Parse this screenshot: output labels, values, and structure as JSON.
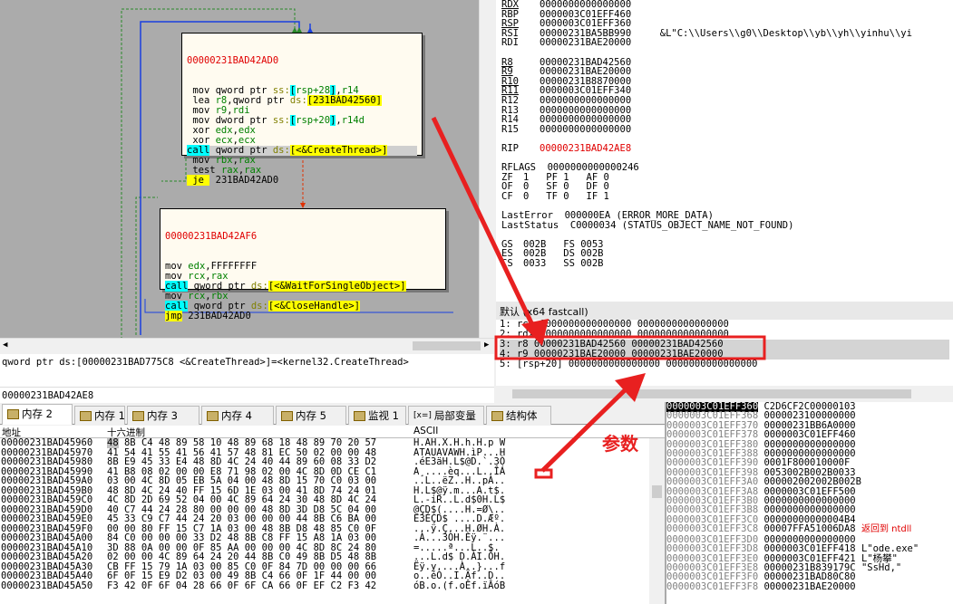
{
  "graph": {
    "node1": {
      "addr": "00000231BAD42AD0",
      "lines": [
        [
          {
            "t": " mov qword ptr "
          },
          {
            "t": "ss:",
            "c": "seg"
          },
          {
            "t": "[",
            "c": "brk"
          },
          {
            "t": "rsp+28",
            "c": "reg"
          },
          {
            "t": "]",
            "c": "brk"
          },
          {
            "t": ","
          },
          {
            "t": "r14",
            "c": "reg"
          }
        ],
        [
          {
            "t": " lea "
          },
          {
            "t": "r8",
            "c": "reg"
          },
          {
            "t": ",qword ptr "
          },
          {
            "t": "ds:",
            "c": "seg"
          },
          {
            "t": "[231BAD42560]",
            "c": "addrhl"
          }
        ],
        [
          {
            "t": " mov "
          },
          {
            "t": "r9",
            "c": "reg"
          },
          {
            "t": ","
          },
          {
            "t": "rdi",
            "c": "reg"
          }
        ],
        [
          {
            "t": " mov dword ptr "
          },
          {
            "t": "ss:",
            "c": "seg"
          },
          {
            "t": "[",
            "c": "brk"
          },
          {
            "t": "rsp+20",
            "c": "reg"
          },
          {
            "t": "]",
            "c": "brk"
          },
          {
            "t": ","
          },
          {
            "t": "r14d",
            "c": "reg"
          }
        ],
        [
          {
            "t": " xor "
          },
          {
            "t": "edx",
            "c": "reg"
          },
          {
            "t": ","
          },
          {
            "t": "edx",
            "c": "reg"
          }
        ],
        [
          {
            "t": " xor "
          },
          {
            "t": "ecx",
            "c": "reg"
          },
          {
            "t": ","
          },
          {
            "t": "ecx",
            "c": "reg"
          }
        ],
        [
          {
            "t": "call",
            "c": "callkw"
          },
          {
            "t": " qword ptr "
          },
          {
            "t": "ds:",
            "c": "seg"
          },
          {
            "t": "[<&CreateThread>]",
            "c": "addrhl"
          }
        ],
        [
          {
            "t": " mov "
          },
          {
            "t": "rbx",
            "c": "reg"
          },
          {
            "t": ","
          },
          {
            "t": "rax",
            "c": "reg"
          }
        ],
        [
          {
            "t": " test "
          },
          {
            "t": "rax",
            "c": "reg"
          },
          {
            "t": ","
          },
          {
            "t": "rax",
            "c": "reg"
          }
        ],
        [
          {
            "t": " je ",
            "c": "jmpkw"
          },
          {
            "t": " 231BAD42AD0"
          }
        ]
      ]
    },
    "node2": {
      "addr": "00000231BAD42AF6",
      "lines": [
        [
          {
            "t": "mov "
          },
          {
            "t": "edx",
            "c": "reg"
          },
          {
            "t": ",FFFFFFFF"
          }
        ],
        [
          {
            "t": "mov "
          },
          {
            "t": "rcx",
            "c": "reg"
          },
          {
            "t": ","
          },
          {
            "t": "rax",
            "c": "reg"
          }
        ],
        [
          {
            "t": "call",
            "c": "callkw"
          },
          {
            "t": " qword ptr "
          },
          {
            "t": "ds:",
            "c": "seg"
          },
          {
            "t": "[<&WaitForSingleObject>]",
            "c": "addrhl"
          }
        ],
        [
          {
            "t": "mov "
          },
          {
            "t": "rcx",
            "c": "reg"
          },
          {
            "t": ","
          },
          {
            "t": "rbx",
            "c": "reg"
          }
        ],
        [
          {
            "t": "call",
            "c": "callkw"
          },
          {
            "t": " qword ptr "
          },
          {
            "t": "ds:",
            "c": "seg"
          },
          {
            "t": "[<&CloseHandle>]",
            "c": "addrhl"
          }
        ],
        [
          {
            "t": "jmp",
            "c": "jmpkw"
          },
          {
            "t": " 231BAD42AD0"
          }
        ]
      ]
    }
  },
  "info": {
    "line1": "qword ptr ds:[00000231BAD775C8 <&CreateThread>]=<kernel32.CreateThread>",
    "line2": "00000231BAD42AE8"
  },
  "registers": {
    "rows": [
      {
        "name": "RDX",
        "value": "0000000000000000",
        "u": true
      },
      {
        "name": "RBP",
        "value": "0000003C01EFF460"
      },
      {
        "name": "RSP",
        "value": "0000003C01EFF360",
        "u": true
      },
      {
        "name": "RSI",
        "value": "00000231BA5BB990",
        "extra": "&L\"C:\\\\Users\\\\g0\\\\Desktop\\\\yb\\\\yh\\\\yinhu\\\\yi"
      },
      {
        "name": "RDI",
        "value": "00000231BAE20000"
      },
      {
        "name": "",
        "value": ""
      },
      {
        "name": "R8",
        "value": "00000231BAD42560",
        "u": true
      },
      {
        "name": "R9",
        "value": "00000231BAE20000",
        "u": true
      },
      {
        "name": "R10",
        "value": "00000231B8870000",
        "u": true
      },
      {
        "name": "R11",
        "value": "0000003C01EFF340",
        "u": true
      },
      {
        "name": "R12",
        "value": "0000000000000000"
      },
      {
        "name": "R13",
        "value": "0000000000000000"
      },
      {
        "name": "R14",
        "value": "0000000000000000"
      },
      {
        "name": "R15",
        "value": "0000000000000000"
      },
      {
        "name": "",
        "value": ""
      },
      {
        "name": "RIP",
        "value": "00000231BAD42AE8",
        "chg": true
      },
      {
        "name": "",
        "value": ""
      },
      {
        "name": "RFLAGS",
        "value": "0000000000000246",
        "wide": true
      },
      {
        "name": "ZF",
        "value": "1   PF 1   AF 0",
        "flag": true
      },
      {
        "name": "OF",
        "value": "0   SF 0   DF 0",
        "flag": true
      },
      {
        "name": "CF",
        "value": "0   TF 0   IF 1",
        "flag": true
      },
      {
        "name": "",
        "value": ""
      },
      {
        "name": "LastError",
        "value": "000000EA (ERROR_MORE_DATA)",
        "wide": true
      },
      {
        "name": "LastStatus",
        "value": "C0000034 (STATUS_OBJECT_NAME_NOT_FOUND)",
        "wide": true
      },
      {
        "name": "",
        "value": ""
      },
      {
        "name": "GS",
        "value": "002B   FS 0053",
        "flag": true
      },
      {
        "name": "ES",
        "value": "002B   DS 002B",
        "flag": true
      },
      {
        "name": "CS",
        "value": "0033   SS 002B",
        "flag": true
      }
    ]
  },
  "callconv": {
    "header": "默认 (x64 fastcall)",
    "rows": [
      "1: rcx 0000000000000000 0000000000000000",
      "2: rdx 0000000000000000 0000000000000000",
      "3: r8 00000231BAD42560 00000231BAD42560",
      "4: r9 00000231BAE20000 00000231BAE20000",
      "5: [rsp+20] 0000000000000000 0000000000000000"
    ]
  },
  "tabs": [
    {
      "label": "内存 2",
      "active": true
    },
    {
      "label": "内存 1"
    },
    {
      "label": "内存 3"
    },
    {
      "label": "内存 4"
    },
    {
      "label": "内存 5"
    },
    {
      "label": "监视 1"
    },
    {
      "label": "局部变量",
      "prefix": "[x=]"
    },
    {
      "label": "结构体"
    }
  ],
  "dump": {
    "headers": {
      "addr": "地址",
      "hex": "十六进制",
      "ascii": "ASCII"
    },
    "rows": [
      {
        "a": "00000231BAD45960",
        "h": "48 8B C4 48 89 58 10 48 89 68 18 48 89 70 20 57",
        "s": "H.AH.X.H.h.H.p W"
      },
      {
        "a": "00000231BAD45970",
        "h": "41 54 41 55 41 56 41 57 48 81 EC 50 02 00 00 48",
        "s": "ATAUAVAWH.ìP...H"
      },
      {
        "a": "00000231BAD45980",
        "h": "8B E9 45 33 E4 48 8D 4C 24 40 44 89 60 08 33 D2",
        "s": ".éE3äH.L$@D.`.3Ò"
      },
      {
        "a": "00000231BAD45990",
        "h": "41 B8 08 02 00 00 E8 71 98 02 00 4C 8D 0D CE C1",
        "s": "A¸....èq...L..ÎÁ"
      },
      {
        "a": "00000231BAD459A0",
        "h": "03 00 4C 8D 05 EB 5A 04 00 48 8D 15 70 C0 03 00",
        "s": "..L..ëZ..H..pÀ.."
      },
      {
        "a": "00000231BAD459B0",
        "h": "48 8D 4C 24 40 FF 15 6D 1E 03 00 41 8D 74 24 01",
        "s": "H.L$@ÿ.m...A.t$."
      },
      {
        "a": "00000231BAD459C0",
        "h": "4C 8D 2D 69 52 04 00 4C 89 64 24 30 48 8D 4C 24",
        "s": "L.-iR..L.d$0H.L$"
      },
      {
        "a": "00000231BAD459D0",
        "h": "40 C7 44 24 28 80 00 00 00 48 8D 3D D8 5C 04 00",
        "s": "@ÇD$(....H.=Ø\\.."
      },
      {
        "a": "00000231BAD459E0",
        "h": "45 33 C9 C7 44 24 20 03 00 00 00 44 8B C6 BA 00",
        "s": "E3ÉÇD$ ....D.Æº."
      },
      {
        "a": "00000231BAD459F0",
        "h": "00 00 80 FF 15 C7 1A 03 00 48 8B D8 48 85 C0 0F",
        "s": "...ÿ.Ç...H.ØH.À."
      },
      {
        "a": "00000231BAD45A00",
        "h": "84 C0 00 00 00 33 D2 48 8B C8 FF 15 A8 1A 03 00",
        "s": ".À...3ÒH.Èÿ.¨..."
      },
      {
        "a": "00000231BAD45A10",
        "h": "3D 88 0A 00 00 0F 85 AA 00 00 00 4C 8D 8C 24 80",
        "s": "=.....ª...L..$."
      },
      {
        "a": "00000231BAD45A20",
        "h": "02 00 00 4C 89 64 24 20 44 8B C0 49 8B D5 48 8B",
        "s": "...L.d$ D.ÀI.ÕH."
      },
      {
        "a": "00000231BAD45A30",
        "h": "CB FF 15 79 1A 03 00 85 C0 0F 84 7D 00 00 00 66",
        "s": "Ëÿ.y....À..}...f"
      },
      {
        "a": "00000231BAD45A40",
        "h": "6F 0F 15 E9 D2 03 00 49 8B C4 66 0F 1F 44 00 00",
        "s": "o..éÒ..I.Äf..D.."
      },
      {
        "a": "00000231BAD45A50",
        "h": "F3 42 0F 6F 04 28 66 0F 6F CA 66 0F EF C2 F3 42",
        "s": "óB.o.(f.oÊf.ïÂóB"
      }
    ]
  },
  "stack": {
    "rows": [
      {
        "a": "0000003C01EFF360",
        "v": "C2D6CF2C00000103",
        "sel": true
      },
      {
        "a": "0000003C01EFF368",
        "v": "0000023100000000"
      },
      {
        "a": "0000003C01EFF370",
        "v": "00000231BB6A0000"
      },
      {
        "a": "0000003C01EFF378",
        "v": "0000003C01EFF460"
      },
      {
        "a": "0000003C01EFF380",
        "v": "0000000000000000"
      },
      {
        "a": "0000003C01EFF388",
        "v": "0000000000000000"
      },
      {
        "a": "0000003C01EFF390",
        "v": "0001F800010000F"
      },
      {
        "a": "0000003C01EFF398",
        "v": "0053002B002B0033"
      },
      {
        "a": "0000003C01EFF3A0",
        "v": "000002002002B002B"
      },
      {
        "a": "0000003C01EFF3A8",
        "v": "0000003C01EFF500"
      },
      {
        "a": "0000003C01EFF3B0",
        "v": "0000000000000000"
      },
      {
        "a": "0000003C01EFF3B8",
        "v": "0000000000000000"
      },
      {
        "a": "0000003C01EFF3C0",
        "v": "00000000000004B4"
      },
      {
        "a": "0000003C01EFF3C8",
        "v": "00007FFA51006DA8",
        "c": "返回到 ntdll"
      },
      {
        "a": "0000003C01EFF3D0",
        "v": "0000000000000000"
      },
      {
        "a": "0000003C01EFF3D8",
        "v": "0000003C01EFF418",
        "c": "L\"ode.exe\""
      },
      {
        "a": "0000003C01EFF3E0",
        "v": "0000003C01EFF421",
        "c": "L\"杨攀\""
      },
      {
        "a": "0000003C01EFF3E8",
        "v": "00000231B839179C",
        "c": "\"SsHd,\""
      },
      {
        "a": "0000003C01EFF3F0",
        "v": "00000231BAD80C80"
      },
      {
        "a": "0000003C01EFF3F8",
        "v": "00000231BAE20000"
      }
    ]
  },
  "annotation": {
    "label": "参数"
  },
  "colors": {
    "arrow": "#e82020",
    "highlight_box": "#e82020"
  }
}
